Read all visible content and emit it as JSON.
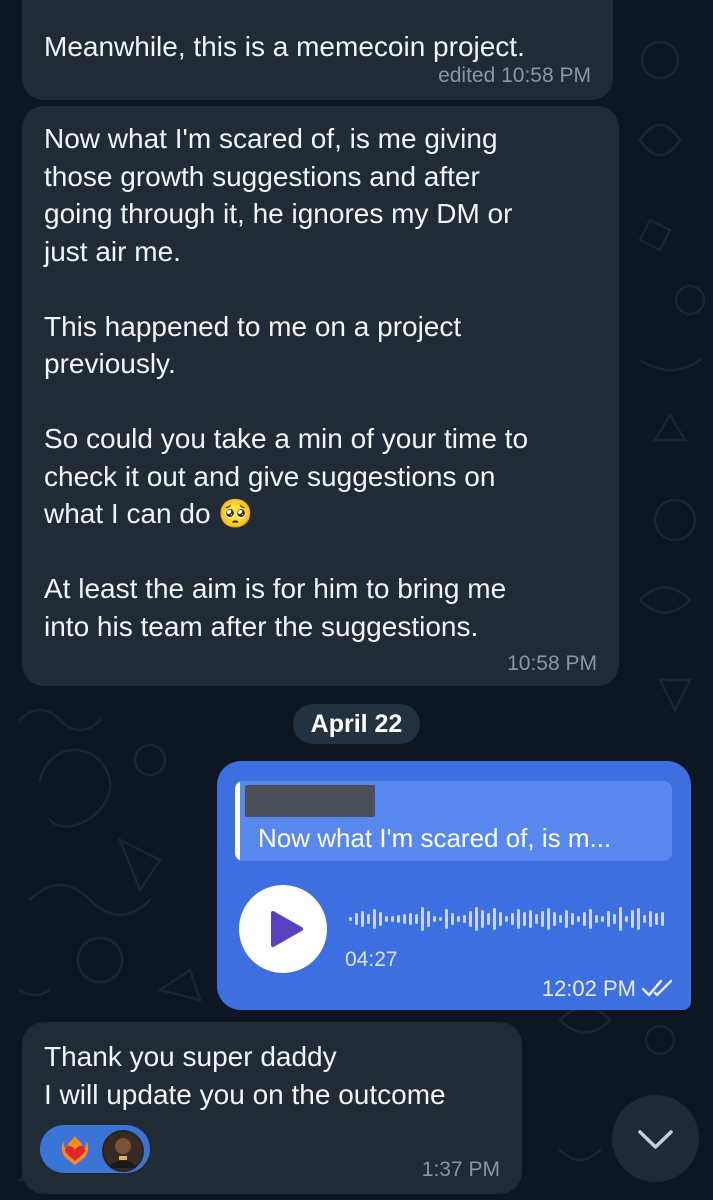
{
  "messages": [
    {
      "id": "m1",
      "direction": "incoming",
      "text": "Meanwhile, this is a memecoin project.",
      "time": "edited 10:58 PM"
    },
    {
      "id": "m2",
      "direction": "incoming",
      "text": "Now what I'm scared of, is me giving\nthose growth suggestions and after\ngoing through it, he ignores my DM or\njust air me.\n\nThis happened to me on a project\npreviously.\n\nSo could you take a min of your time to\ncheck it out and give suggestions on\nwhat I can do 🥺\n\nAt least the aim is for him to bring me\ninto his team after the suggestions.",
      "time": "10:58 PM"
    },
    {
      "id": "m3",
      "direction": "outgoing",
      "type": "voice",
      "reply_preview": "Now what I'm scared of, is m...",
      "duration": "04:27",
      "time": "12:02 PM",
      "status": "read",
      "status_icon": "double-check-icon"
    },
    {
      "id": "m4",
      "direction": "incoming",
      "text": "Thank you super daddy\nI will update you on the outcome",
      "time": "1:37 PM",
      "reactions": [
        "heart-on-fire-emoji",
        "user-avatar-reaction"
      ]
    }
  ],
  "date_separator": "April 22",
  "scroll_button_icon": "chevron-down-icon",
  "colors": {
    "background": "#0e1621",
    "incoming_bubble": "#212b36",
    "outgoing_bubble": "#3d6fe0",
    "reply_box": "#5887ee",
    "timestamp_incoming": "#8996a5"
  }
}
